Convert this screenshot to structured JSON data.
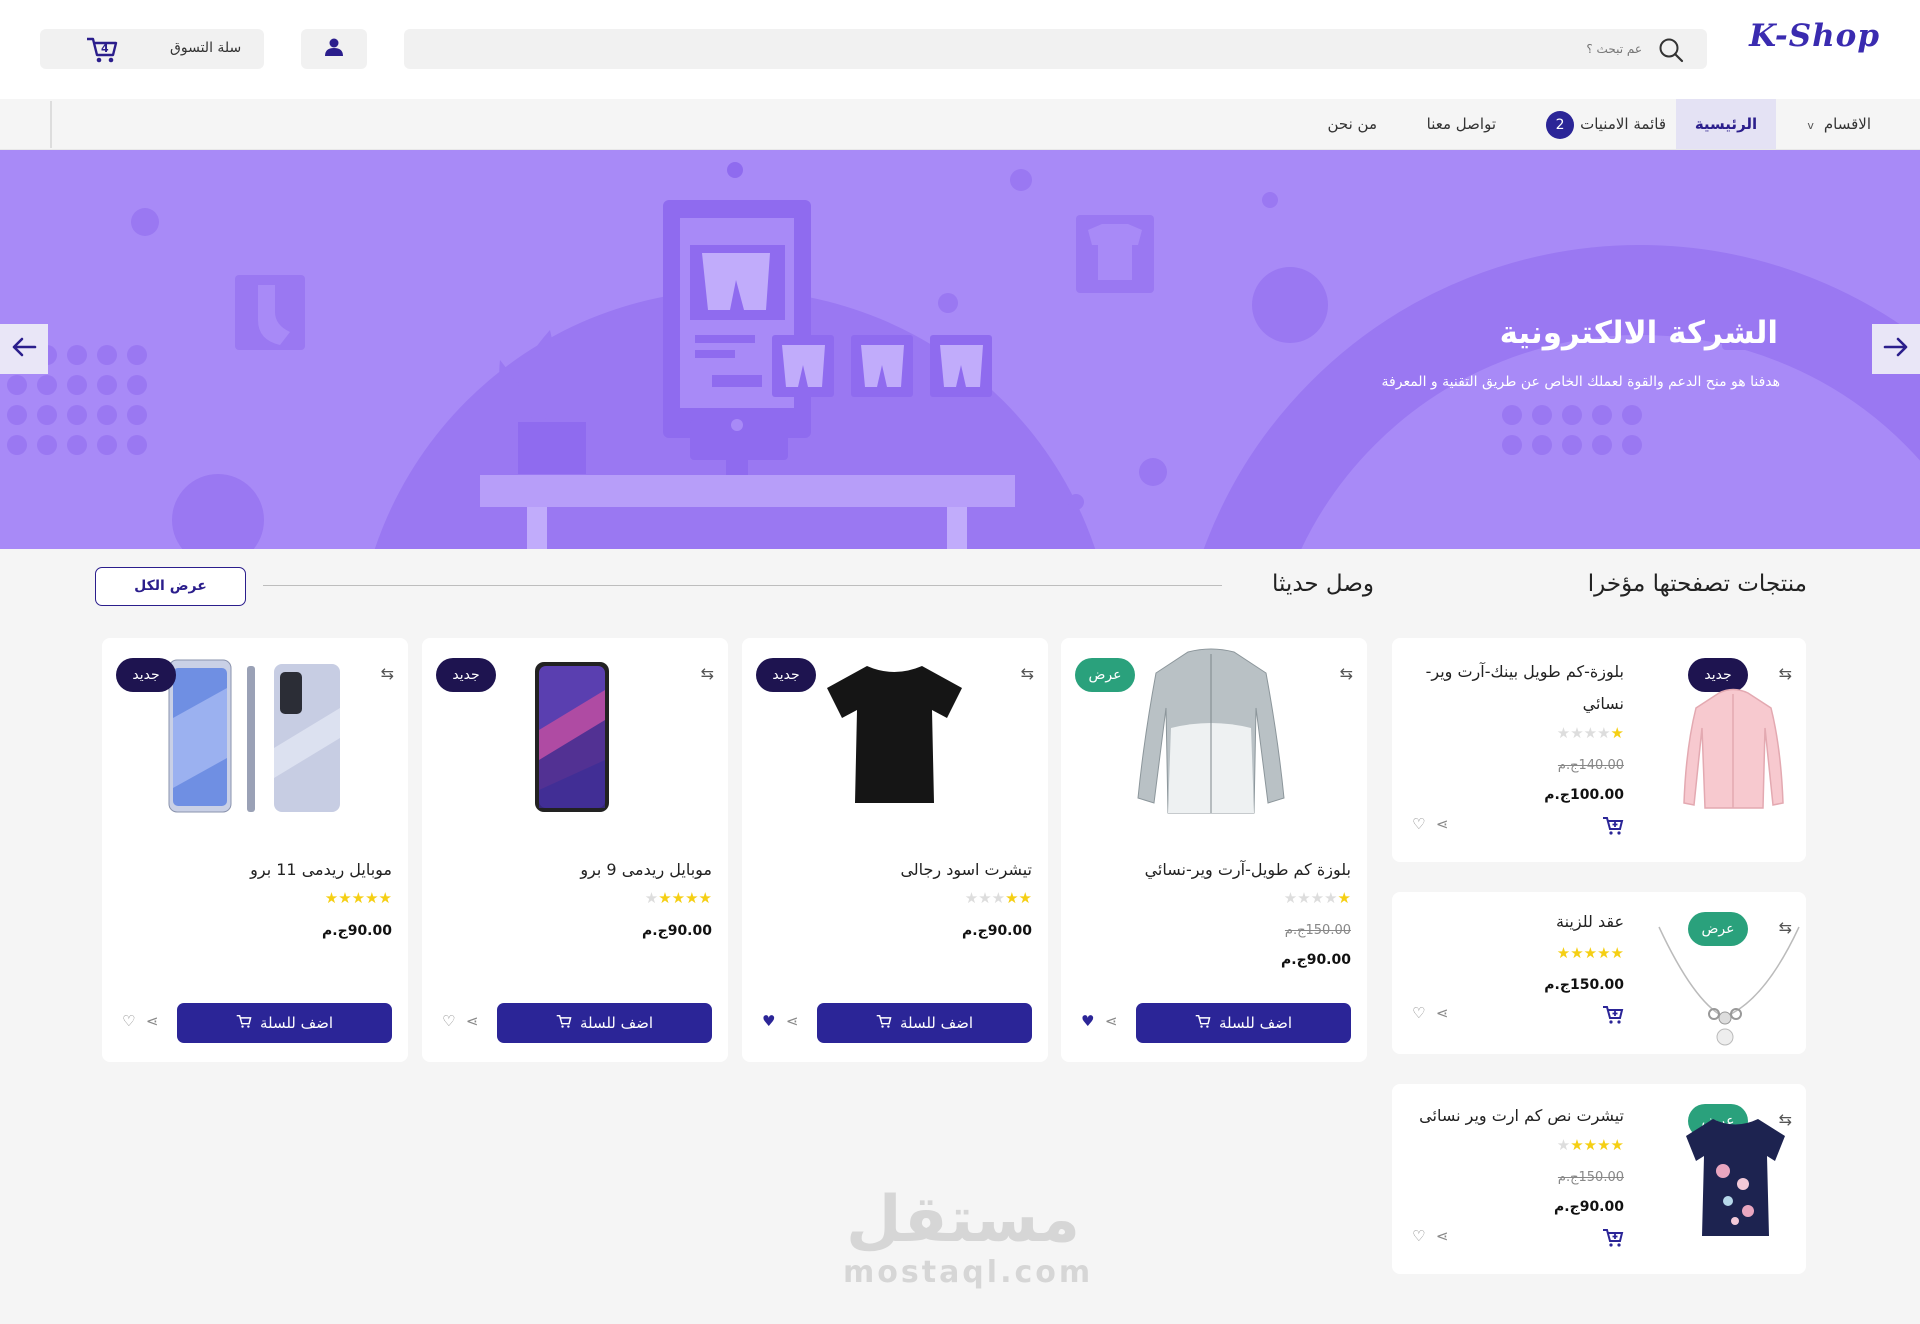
{
  "header": {
    "logo": "K-Shop",
    "search_placeholder": "عم تبحث ؟",
    "cart_label": "سلة التسوق",
    "cart_count": "4"
  },
  "nav": {
    "categories": "الاقسام",
    "home": "الرئيسية",
    "wishlist": "قائمة الامنيات",
    "wishlist_count": "2",
    "contact": "تواصل معنا",
    "about": "من نحن"
  },
  "banner": {
    "title": "الشركة الالكترونية",
    "subtitle": "هدفنا هو منح الدعم والقوة لعملك الخاص عن طريق التقنية و المعرفة"
  },
  "sections": {
    "recent_title": "منتجات تصفحتها مؤخرا",
    "new_title": "وصل حديثا",
    "view_all": "عرض الكل"
  },
  "labels": {
    "add_to_cart": "اضف للسلة"
  },
  "recent": [
    {
      "title": "بلوزة-كم طويل بينك-آرت وير-نسائي",
      "tag": "جديد",
      "rating": 1,
      "old_price": "140.00ج.م",
      "price": "100.00ج.م"
    },
    {
      "title": "عقد للزينة",
      "tag": "عرض",
      "rating": 5,
      "old_price": "",
      "price": "150.00ج.م"
    },
    {
      "title": "تيشرت نص كم ارت وير نسائى",
      "tag": "عرض",
      "rating": 4,
      "old_price": "150.00ج.م",
      "price": "90.00ج.م"
    }
  ],
  "new_arrivals": [
    {
      "title": "بلوزة كم طويل-آرت وير-نسائي",
      "tag": "عرض",
      "rating": 1,
      "old_price": "150.00ج.م",
      "price": "90.00ج.م",
      "liked": true
    },
    {
      "title": "تيشرت اسود رجالى",
      "tag": "جديد",
      "rating": 2,
      "old_price": "",
      "price": "90.00ج.م",
      "liked": true
    },
    {
      "title": "موبايل ريدمى 9 برو",
      "tag": "جديد",
      "rating": 4,
      "old_price": "",
      "price": "90.00ج.م",
      "liked": false
    },
    {
      "title": "موبايل ريدمى 11 برو",
      "tag": "جديد",
      "rating": 5,
      "old_price": "",
      "price": "90.00ج.م",
      "liked": false
    }
  ],
  "watermark": {
    "arabic": "مستقل",
    "latin": "mostaql.com"
  },
  "colors": {
    "primary": "#2b2597",
    "banner": "#a88af7",
    "new_tag": "#1e1450",
    "sale_tag": "#2aa17c",
    "star": "#f5cf14"
  }
}
